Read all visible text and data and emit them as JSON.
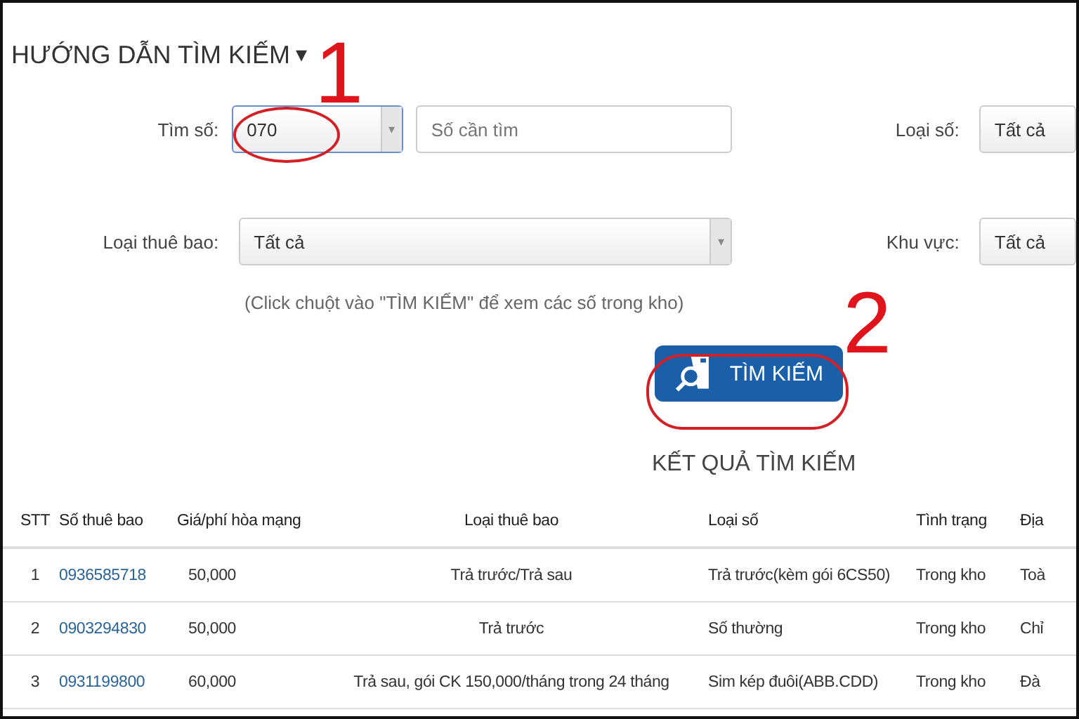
{
  "guide": {
    "title": "HƯỚNG DẪN TÌM KIẾM",
    "caret": "▾"
  },
  "form": {
    "search_label": "Tìm số:",
    "prefix_select": {
      "value": "070",
      "caret": "▾"
    },
    "number_field": {
      "placeholder": "Số cần tìm"
    },
    "number_type_label": "Loại số:",
    "number_type_select": {
      "value": "Tất cả"
    },
    "subscriber_type_label": "Loại thuê bao:",
    "subscriber_type_select": {
      "value": "Tất cả",
      "caret": "▾"
    },
    "area_label": "Khu vực:",
    "area_select": {
      "value": "Tất cả"
    },
    "hint": "(Click chuột vào \"TÌM KIẾM\" để xem các số trong kho)",
    "search_button": "TÌM KIẾM"
  },
  "annotations": [
    "1",
    "2"
  ],
  "results": {
    "title": "KẾT QUẢ TÌM KIẾM",
    "columns": [
      "STT",
      "Số thuê bao",
      "Giá/phí hòa mạng",
      "Loại thuê bao",
      "Loại số",
      "Tình trạng",
      "Địa"
    ],
    "rows": [
      [
        "1",
        "0936585718",
        "50,000",
        "Trả trước/Trả sau",
        "Trả trước(kèm gói 6CS50)",
        "Trong kho",
        "Toà"
      ],
      [
        "2",
        "0903294830",
        "50,000",
        "Trả trước",
        "Số thường",
        "Trong kho",
        "Chỉ"
      ],
      [
        "3",
        "0931199800",
        "60,000",
        "Trả sau, gói CK 150,000/tháng trong 24 tháng",
        "Sim kép đuôi(ABB.CDD)",
        "Trong kho",
        "Đà"
      ]
    ]
  }
}
